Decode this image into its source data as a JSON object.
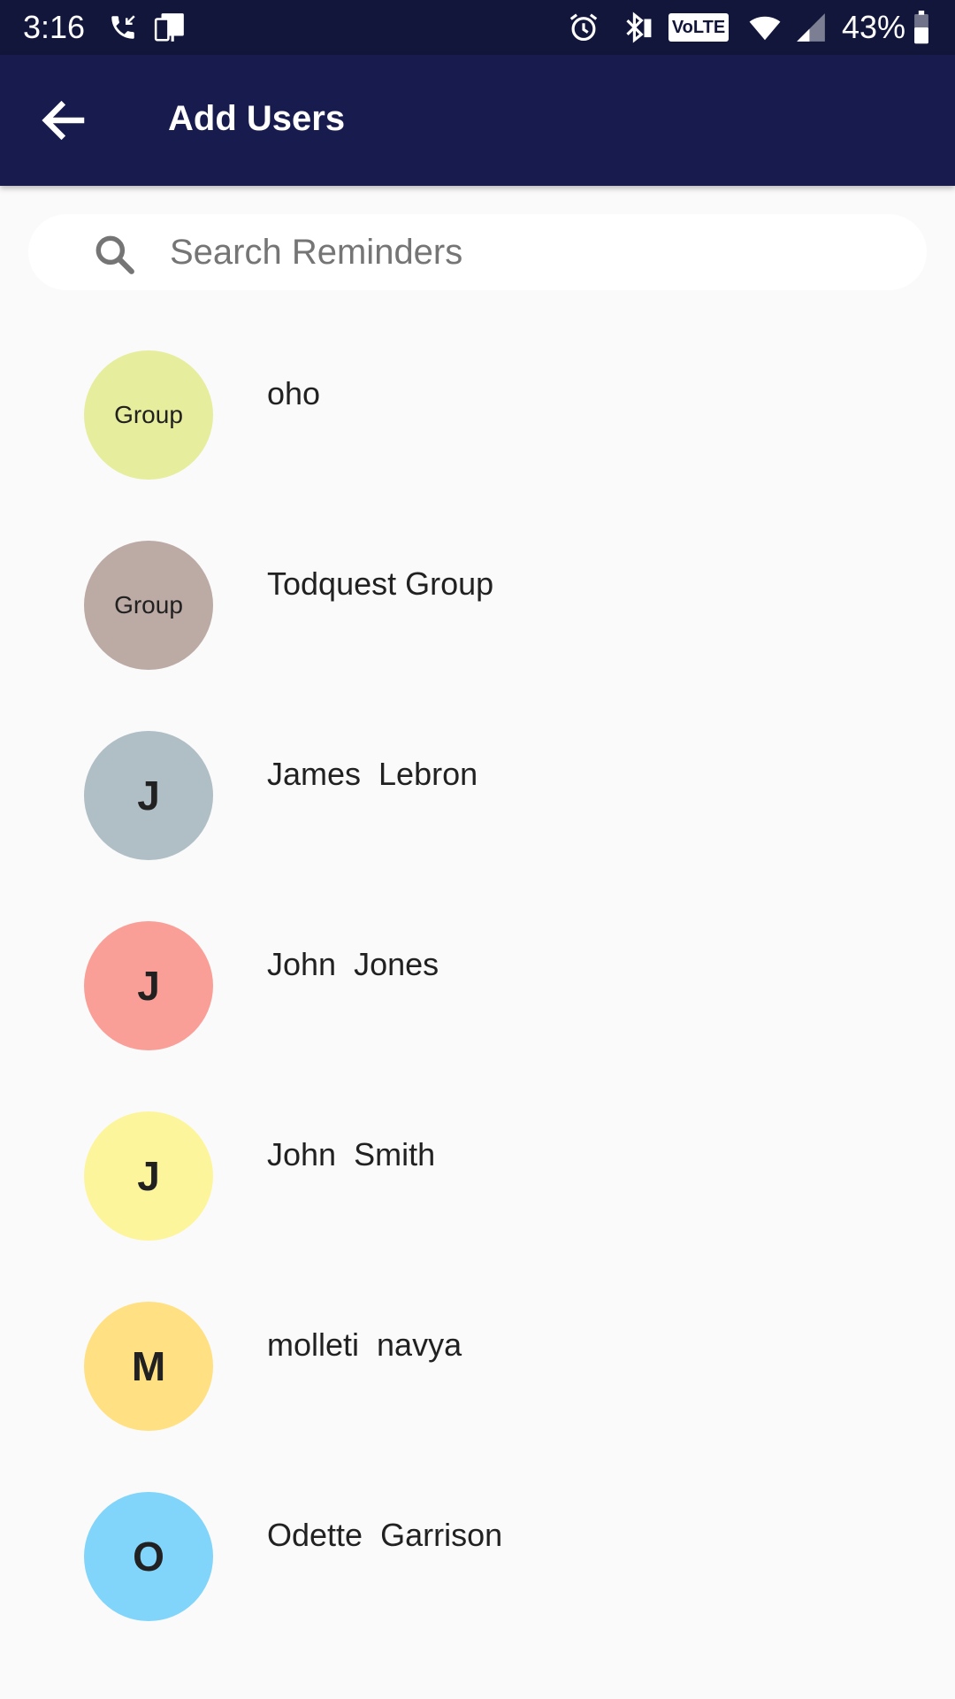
{
  "status_bar": {
    "time": "3:16",
    "battery": "43%",
    "icons": [
      "missed-call-icon",
      "device-icon",
      "alarm-icon",
      "bluetooth-icon",
      "volte-icon",
      "wifi-icon",
      "signal-icon",
      "battery-icon"
    ],
    "volte_label": "VoLTE"
  },
  "app_bar": {
    "title": "Add Users",
    "back_icon": "arrow-back-icon",
    "background": "#171b4d"
  },
  "search": {
    "placeholder": "Search Reminders",
    "value": ""
  },
  "users": [
    {
      "name": "oho",
      "avatar_text": "Group",
      "avatar_color": "#e6ed9c",
      "avatar_kind": "group"
    },
    {
      "name": "Todquest Group",
      "avatar_text": "Group",
      "avatar_color": "#bcaaa4",
      "avatar_kind": "group"
    },
    {
      "name": "James  Lebron",
      "avatar_text": "J",
      "avatar_color": "#b0bec5",
      "avatar_kind": "letter"
    },
    {
      "name": "John  Jones",
      "avatar_text": "J",
      "avatar_color": "#f99f97",
      "avatar_kind": "letter"
    },
    {
      "name": "John  Smith",
      "avatar_text": "J",
      "avatar_color": "#fdf59b",
      "avatar_kind": "letter"
    },
    {
      "name": "molleti  navya",
      "avatar_text": "M",
      "avatar_color": "#ffe082",
      "avatar_kind": "letter"
    },
    {
      "name": "Odette  Garrison",
      "avatar_text": "O",
      "avatar_color": "#81d4fa",
      "avatar_kind": "letter"
    }
  ]
}
